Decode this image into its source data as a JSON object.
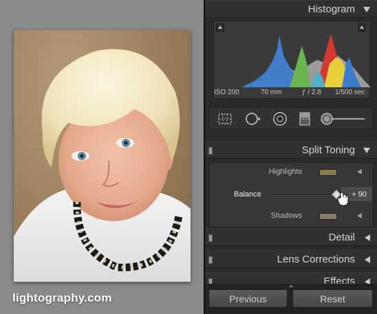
{
  "preview": {
    "watermark": "lightography.com"
  },
  "histogram": {
    "title": "Histogram",
    "iso": "ISO 200",
    "focal_length": "70 mm",
    "aperture": "ƒ / 2.8",
    "shutter": "1/500 sec"
  },
  "split_toning": {
    "title": "Split Toning",
    "highlights_label": "Highlights",
    "highlights_color": "#857d4e",
    "balance_label": "Balance",
    "balance_value": "+ 90",
    "balance_level": 0.95,
    "shadows_label": "Shadows",
    "shadows_color": "#867c66"
  },
  "sections": {
    "detail": "Detail",
    "lens_corrections": "Lens Corrections",
    "effects": "Effects"
  },
  "buttons": {
    "previous": "Previous",
    "reset": "Reset"
  }
}
